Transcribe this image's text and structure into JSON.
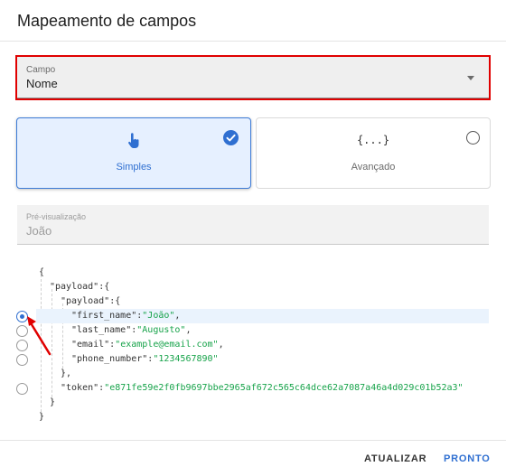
{
  "dialog": {
    "title": "Mapeamento de campos"
  },
  "field_select": {
    "label": "Campo",
    "value": "Nome"
  },
  "modes": {
    "simple": {
      "label": "Simples",
      "selected": true,
      "icon": "pointer-hand-icon"
    },
    "advanced": {
      "label": "Avançado",
      "selected": false,
      "glyph": "{...}"
    }
  },
  "preview": {
    "label": "Pré-visualização",
    "value": "João"
  },
  "json_tree": {
    "lines": [
      {
        "text": "{"
      },
      {
        "key": "\"payload\"",
        "sep": ":{"
      },
      {
        "key": "\"payload\"",
        "sep": ":{"
      },
      {
        "key": "\"first_name\"",
        "sep": ":",
        "value": "\"João\"",
        "end": ",",
        "selectable": true,
        "selected": true
      },
      {
        "key": "\"last_name\"",
        "sep": ":",
        "value": "\"Augusto\"",
        "end": ",",
        "selectable": true,
        "selected": false
      },
      {
        "key": "\"email\"",
        "sep": ":",
        "value": "\"example@email.com\"",
        "end": ",",
        "selectable": true,
        "selected": false
      },
      {
        "key": "\"phone_number\"",
        "sep": ":",
        "value": "\"1234567890\"",
        "end": "",
        "selectable": true,
        "selected": false
      },
      {
        "text": "},"
      },
      {
        "key": "\"token\"",
        "sep": ":",
        "value": "\"e871fe59e2f0fb9697bbe2965af672c565c64dce62a7087a46a4d029c01b52a3\"",
        "end": "",
        "selectable": true,
        "selected": false
      },
      {
        "text": "}"
      },
      {
        "text": "}"
      }
    ]
  },
  "actions": {
    "update_label": "ATUALIZAR",
    "done_label": "PRONTO"
  },
  "colors": {
    "accent": "#2f6fd1",
    "string_value": "#17a34a",
    "highlight_border": "#e00000",
    "annotation_arrow": "#e00000"
  }
}
